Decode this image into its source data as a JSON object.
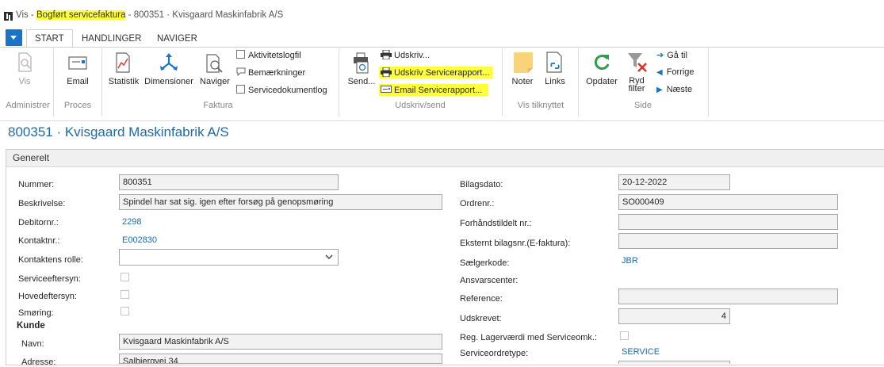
{
  "window": {
    "title_prefix": "Vis - ",
    "title_highlight": "Bogført servicefaktura",
    "title_suffix": " - 800351 · Kvisgaard Maskinfabrik A/S"
  },
  "tabs": [
    "START",
    "HANDLINGER",
    "NAVIGER"
  ],
  "ribbon": {
    "vis": "Vis",
    "email": "Email",
    "statistik": "Statistik",
    "dimensioner": "Dimensioner",
    "naviger": "Naviger",
    "aktivitetslogfil": "Aktivitetslogfil",
    "bemaerkninger": "Bemærkninger",
    "servicedokumentlog": "Servicedokumentlog",
    "send": "Send...",
    "udskriv": "Udskriv...",
    "udskriv_servicerapport": "Udskriv Servicerapport...",
    "email_servicerapport": "Email Servicerapport...",
    "noter": "Noter",
    "links": "Links",
    "opdater": "Opdater",
    "ryd_filter_1": "Ryd",
    "ryd_filter_2": "filter",
    "ga_til": "Gå til",
    "forrige": "Forrige",
    "naeste": "Næste",
    "groups": {
      "administrer": "Administrer",
      "proces": "Proces",
      "faktura": "Faktura",
      "udskriv_send": "Udskriv/send",
      "vis_tilknyttet": "Vis tilknyttet",
      "side": "Side"
    }
  },
  "page_title": "800351 · Kvisgaard Maskinfabrik A/S",
  "section_title": "Generelt",
  "left": {
    "nummer_label": "Nummer:",
    "nummer_value": "800351",
    "beskrivelse_label": "Beskrivelse:",
    "beskrivelse_value": "Spindel har sat sig. igen efter forsøg på genopsmøring",
    "debitornr_label": "Debitornr.:",
    "debitornr_value": "2298",
    "kontaktnr_label": "Kontaktnr.:",
    "kontaktnr_value": "E002830",
    "kontaktens_rolle_label": "Kontaktens rolle:",
    "kontaktens_rolle_value": "",
    "serviceeftersyn_label": "Serviceeftersyn:",
    "hovedeftersyn_label": "Hovedeftersyn:",
    "smoering_label": "Smøring:",
    "kunde_heading": "Kunde",
    "navn_label": "Navn:",
    "navn_value": "Kvisgaard Maskinfabrik A/S",
    "adresse_label": "Adresse:",
    "adresse_value": "Salbjergvej 34"
  },
  "right": {
    "bilagsdato_label": "Bilagsdato:",
    "bilagsdato_value": "20-12-2022",
    "ordrenr_label": "Ordrenr.:",
    "ordrenr_value": "SO000409",
    "forhaandstildelt_label": "Forhåndstildelt nr.:",
    "forhaandstildelt_value": "",
    "eksternt_label": "Eksternt bilagsnr.(E-faktura):",
    "eksternt_value": "",
    "saelgerkode_label": "Sælgerkode:",
    "saelgerkode_value": "JBR",
    "ansvarscenter_label": "Ansvarscenter:",
    "reference_label": "Reference:",
    "reference_value": "",
    "udskrevet_label": "Udskrevet:",
    "udskrevet_value": "4",
    "reg_lager_label": "Reg. Lagerværdi med Serviceomk.:",
    "serviceordretype_label": "Serviceordretype:",
    "serviceordretype_value": "SERVICE"
  },
  "colors": {
    "accent": "#1f6aa5",
    "highlight": "#ffff3c",
    "menu_button": "#1a73c8"
  }
}
